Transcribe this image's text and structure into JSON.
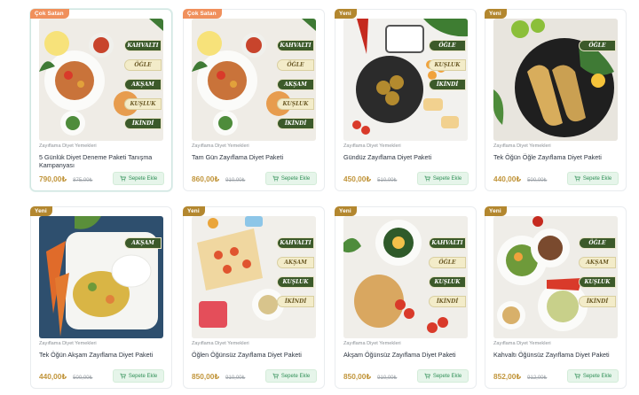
{
  "cart_button_label": "Sepete Ekle",
  "colors": {
    "badge_new": "#b3872f",
    "badge_hot": "#f0905c",
    "price": "#c1953b",
    "cart_button_bg": "#e6f5ea",
    "cart_button_text": "#2f8f56"
  },
  "products": [
    {
      "badge": "Çok Satan",
      "image_icon": "meal-plan-full-icon",
      "category": "Zayıflama Diyet Yemekleri",
      "title": "5 Günlük Diyet Deneme Paketi Tanışma Kampanyası",
      "price": "790,00₺",
      "old_price": "875,00₺",
      "meal_tags": [
        "KAHVALTI",
        "ÖĞLE",
        "AKŞAM",
        "KUŞLUK",
        "İKİNDİ"
      ]
    },
    {
      "badge": "Çok Satan",
      "image_icon": "meal-plan-full-icon",
      "category": "Zayıflama Diyet Yemekleri",
      "title": "Tam Gün Zayıflama Diyet Paketi",
      "price": "860,00₺",
      "old_price": "910,00₺",
      "meal_tags": [
        "KAHVALTI",
        "ÖĞLE",
        "AKŞAM",
        "KUŞLUK",
        "İKİNDİ"
      ]
    },
    {
      "badge": "Yeni",
      "image_icon": "daytime-meal-icon",
      "category": "Zayıflama Diyet Yemekleri",
      "title": "Gündüz Zayıflama Diyet Paketi",
      "price": "450,00₺",
      "old_price": "510,00₺",
      "meal_tags": [
        "ÖĞLE",
        "KUŞLUK",
        "İKİNDİ"
      ]
    },
    {
      "badge": "Yeni",
      "image_icon": "fish-plate-icon",
      "category": "Zayıflama Diyet Yemekleri",
      "title": "Tek Öğün Öğle Zayıflama Diyet Paketi",
      "price": "440,00₺",
      "old_price": "500,00₺",
      "meal_tags": [
        "ÖĞLE"
      ]
    },
    {
      "badge": "Yeni",
      "image_icon": "vegetable-plate-icon",
      "category": "Zayıflama Diyet Yemekleri",
      "title": "Tek Öğün Akşam Zayıflama Diyet Paketi",
      "price": "440,00₺",
      "old_price": "500,00₺",
      "meal_tags": [
        "AKŞAM"
      ]
    },
    {
      "badge": "Yeni",
      "image_icon": "lunch-meal-icon",
      "category": "Zayıflama Diyet Yemekleri",
      "title": "Öğlen Öğünsüz Zayıflama Diyet Paketi",
      "price": "850,00₺",
      "old_price": "910,00₺",
      "meal_tags": [
        "KAHVALTI",
        "AKŞAM",
        "KUŞLUK",
        "İKİNDİ"
      ]
    },
    {
      "badge": "Yeni",
      "image_icon": "dinner-meal-icon",
      "category": "Zayıflama Diyet Yemekleri",
      "title": "Akşam Öğünsüz Zayıflama Diyet Paketi",
      "price": "850,00₺",
      "old_price": "910,00₺",
      "meal_tags": [
        "KAHVALTI",
        "ÖĞLE",
        "KUŞLUK",
        "İKİNDİ"
      ]
    },
    {
      "badge": "Yeni",
      "image_icon": "breakfast-meal-icon",
      "category": "Zayıflama Diyet Yemekleri",
      "title": "Kahvaltı Öğünsüz Zayıflama Diyet Paketi",
      "price": "852,00₺",
      "old_price": "912,00₺",
      "meal_tags": [
        "ÖĞLE",
        "AKŞAM",
        "KUŞLUK",
        "İKİNDİ"
      ]
    }
  ]
}
